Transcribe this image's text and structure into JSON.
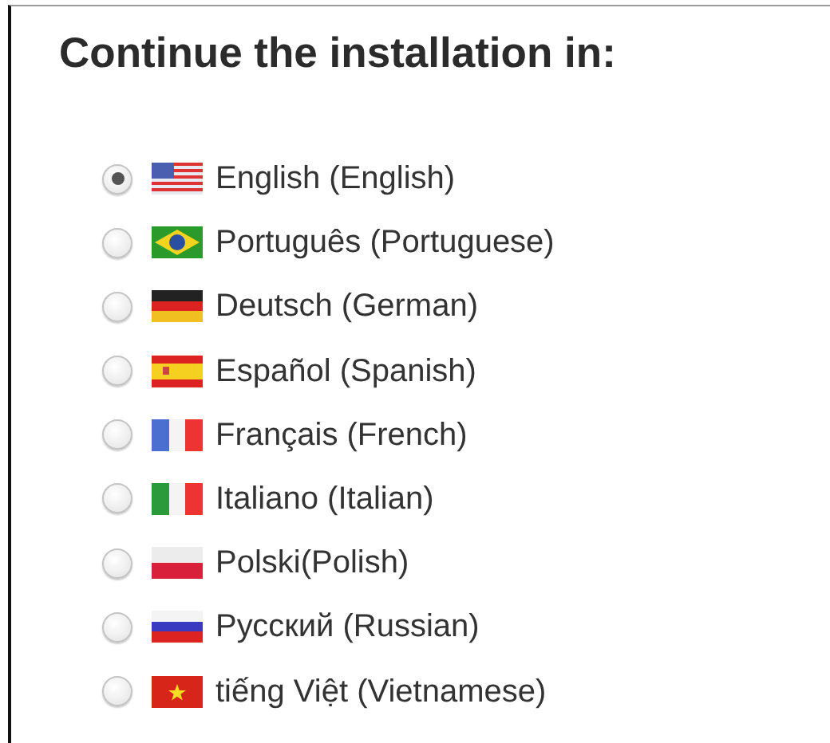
{
  "heading": "Continue the installation in:",
  "languages": [
    {
      "label": "English (English)",
      "kind": "us",
      "selected": true
    },
    {
      "label": "Português (Portuguese)",
      "kind": "br",
      "selected": false
    },
    {
      "label": "Deutsch (German)",
      "kind": "de",
      "selected": false
    },
    {
      "label": "Español (Spanish)",
      "kind": "es",
      "selected": false
    },
    {
      "label": "Français (French)",
      "kind": "fr",
      "selected": false
    },
    {
      "label": "Italiano (Italian)",
      "kind": "it",
      "selected": false
    },
    {
      "label": "Polski(Polish)",
      "kind": "pl",
      "selected": false
    },
    {
      "label": "Русский (Russian)",
      "kind": "ru",
      "selected": false
    },
    {
      "label": "tiếng Việt (Vietnamese)",
      "kind": "vn",
      "selected": false
    }
  ]
}
